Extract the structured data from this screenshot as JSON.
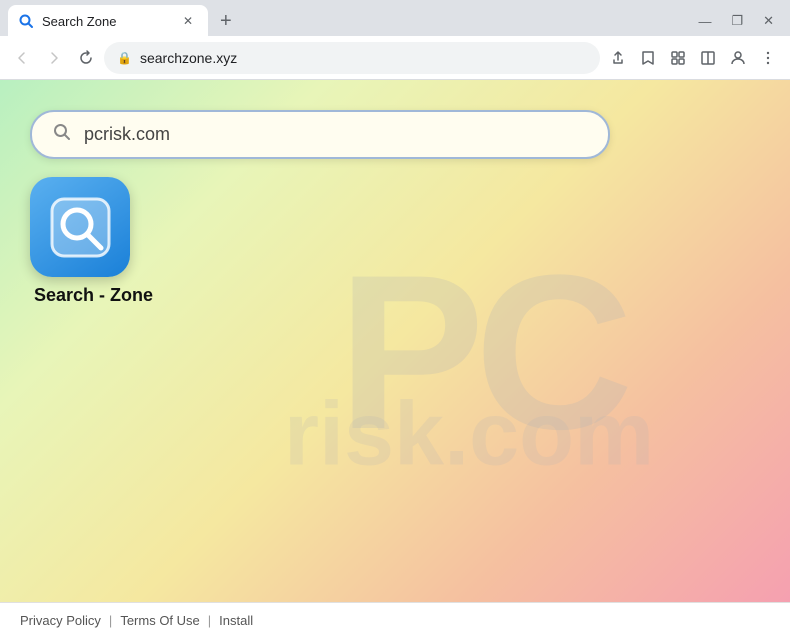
{
  "browser": {
    "tab": {
      "title": "Search Zone",
      "favicon_label": "search-zone-favicon"
    },
    "new_tab_label": "+",
    "window_controls": {
      "minimize": "—",
      "maximize": "❐",
      "close": "✕"
    },
    "nav": {
      "back_label": "←",
      "forward_label": "→",
      "reload_label": "↻",
      "url": "searchzone.xyz",
      "share_label": "⬆",
      "bookmark_label": "☆",
      "extensions_label": "🧩",
      "split_label": "⧉",
      "profile_label": "👤",
      "menu_label": "⋮"
    }
  },
  "page": {
    "search": {
      "placeholder": "pcrisk.com",
      "value": "pcrisk.com"
    },
    "logo": {
      "label": "Search - Zone"
    },
    "watermark": {
      "line1": "PC",
      "line2": "risk.com"
    },
    "footer": {
      "privacy_policy": "Privacy Policy",
      "separator1": "|",
      "terms_of_use": "Terms Of Use",
      "separator2": "|",
      "install": "Install"
    }
  }
}
